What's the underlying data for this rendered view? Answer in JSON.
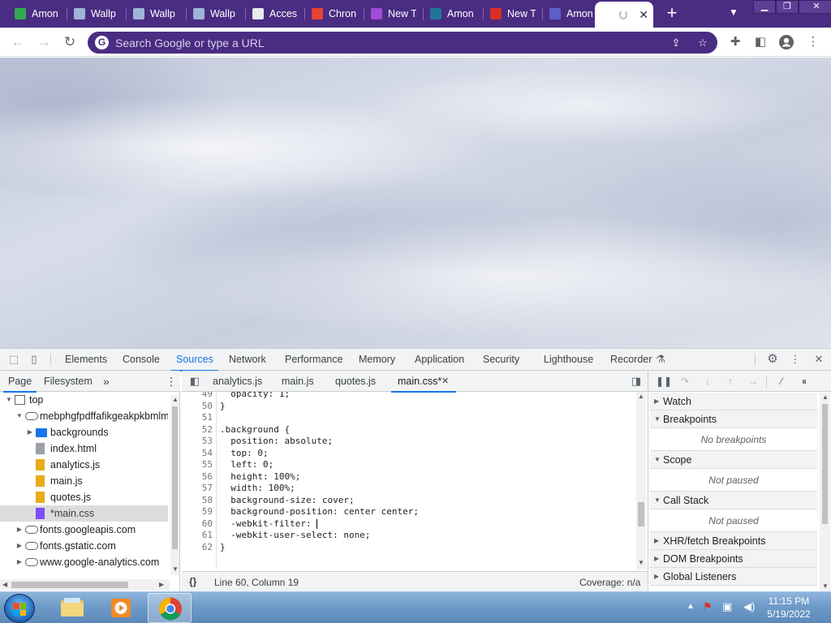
{
  "browser": {
    "tabs": [
      {
        "title": "Amon",
        "icon": "shield-icon",
        "color": "#34a853"
      },
      {
        "title": "Wallp",
        "icon": "page-icon",
        "color": "#9fb4d9"
      },
      {
        "title": "Wallp",
        "icon": "page-icon",
        "color": "#9fb4d9"
      },
      {
        "title": "Wallp",
        "icon": "page-icon",
        "color": "#9fb4d9"
      },
      {
        "title": "Acces",
        "icon": "globe-icon",
        "color": "#e8eaed"
      },
      {
        "title": "Chron",
        "icon": "chrome-icon",
        "color": "#ea4335"
      },
      {
        "title": "New T",
        "icon": "new-tab-logo-icon",
        "color": "#a04bd6"
      },
      {
        "title": "Amon",
        "icon": "wordpress-icon",
        "color": "#21759b"
      },
      {
        "title": "New T",
        "icon": "new-tab-red-icon",
        "color": "#d93025"
      },
      {
        "title": "Amon",
        "icon": "u-logo-icon",
        "color": "#5b5fc7"
      }
    ],
    "active_tab": {
      "title": "",
      "loading": true
    },
    "new_tab_label": "+",
    "window_controls": {
      "minimize": "▁",
      "restore": "❐",
      "close": "✕"
    }
  },
  "toolbar": {
    "back": "←",
    "forward": "→",
    "reload": "↻",
    "omnibox_placeholder": "Search Google or type a URL",
    "google_badge": "G"
  },
  "devtools": {
    "tabs": [
      "Elements",
      "Console",
      "Sources",
      "Network",
      "Performance",
      "Memory",
      "Application",
      "Security",
      "Lighthouse",
      "Recorder"
    ],
    "active_tab": "Sources",
    "navigator": {
      "tabs": [
        "Page",
        "Filesystem"
      ],
      "more": "»",
      "tree": [
        {
          "label": "top",
          "level": 0,
          "expanded": true,
          "type": "frame"
        },
        {
          "label": "mebphgfpdffafikgeakpkbmlm",
          "level": 1,
          "expanded": true,
          "type": "cloud"
        },
        {
          "label": "backgrounds",
          "level": 2,
          "expanded": false,
          "type": "folder"
        },
        {
          "label": "index.html",
          "level": 2,
          "type": "html"
        },
        {
          "label": "analytics.js",
          "level": 2,
          "type": "file"
        },
        {
          "label": "main.js",
          "level": 2,
          "type": "file"
        },
        {
          "label": "quotes.js",
          "level": 2,
          "type": "file"
        },
        {
          "label": "*main.css",
          "level": 2,
          "type": "css",
          "selected": true
        },
        {
          "label": "fonts.googleapis.com",
          "level": 1,
          "expanded": false,
          "type": "cloud"
        },
        {
          "label": "fonts.gstatic.com",
          "level": 1,
          "expanded": false,
          "type": "cloud"
        },
        {
          "label": "www.google-analytics.com",
          "level": 1,
          "expanded": false,
          "type": "cloud"
        }
      ]
    },
    "editor": {
      "tabs": [
        "analytics.js",
        "main.js",
        "quotes.js",
        "main.css*"
      ],
      "active_tab": "main.css*",
      "lines": [
        {
          "n": "49",
          "text": "  opacity: 1;"
        },
        {
          "n": "50",
          "text": "}"
        },
        {
          "n": "51",
          "text": ""
        },
        {
          "n": "52",
          "text": ".background {"
        },
        {
          "n": "53",
          "text": "  position: absolute;"
        },
        {
          "n": "54",
          "text": "  top: 0;"
        },
        {
          "n": "55",
          "text": "  left: 0;"
        },
        {
          "n": "56",
          "text": "  height: 100%;"
        },
        {
          "n": "57",
          "text": "  width: 100%;"
        },
        {
          "n": "58",
          "text": "  background-size: cover;"
        },
        {
          "n": "59",
          "text": "  background-position: center center;"
        },
        {
          "n": "60",
          "text": "  -webkit-filter: "
        },
        {
          "n": "61",
          "text": "  -webkit-user-select: none;"
        },
        {
          "n": "62",
          "text": "}"
        }
      ],
      "status_left": "Line 60, Column 19",
      "status_right": "Coverage: n/a",
      "pretty_print": "{}"
    },
    "debugger": {
      "panes": [
        {
          "title": "Watch",
          "expanded": false
        },
        {
          "title": "Breakpoints",
          "expanded": true,
          "body": "No breakpoints"
        },
        {
          "title": "Scope",
          "expanded": true,
          "body": "Not paused"
        },
        {
          "title": "Call Stack",
          "expanded": true,
          "body": "Not paused"
        },
        {
          "title": "XHR/fetch Breakpoints",
          "expanded": false
        },
        {
          "title": "DOM Breakpoints",
          "expanded": false
        },
        {
          "title": "Global Listeners",
          "expanded": false
        }
      ]
    }
  },
  "taskbar": {
    "time": "11:15 PM",
    "date": "5/19/2022"
  }
}
